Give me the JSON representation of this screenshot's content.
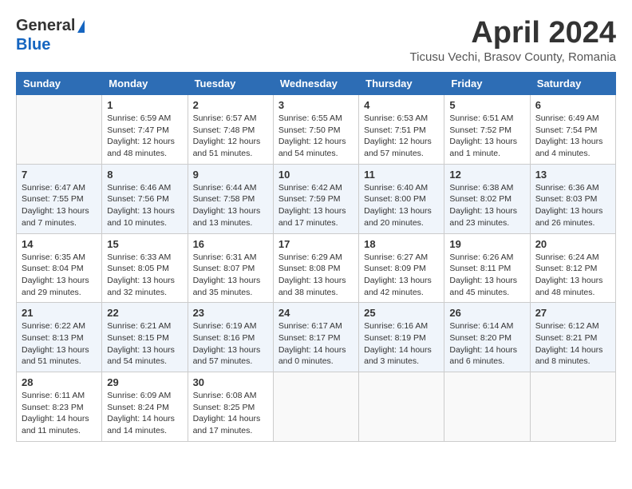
{
  "header": {
    "logo_general": "General",
    "logo_blue": "Blue",
    "month_year": "April 2024",
    "location": "Ticusu Vechi, Brasov County, Romania"
  },
  "days_of_week": [
    "Sunday",
    "Monday",
    "Tuesday",
    "Wednesday",
    "Thursday",
    "Friday",
    "Saturday"
  ],
  "weeks": [
    [
      {
        "day": "",
        "sunrise": "",
        "sunset": "",
        "daylight": ""
      },
      {
        "day": "1",
        "sunrise": "Sunrise: 6:59 AM",
        "sunset": "Sunset: 7:47 PM",
        "daylight": "Daylight: 12 hours and 48 minutes."
      },
      {
        "day": "2",
        "sunrise": "Sunrise: 6:57 AM",
        "sunset": "Sunset: 7:48 PM",
        "daylight": "Daylight: 12 hours and 51 minutes."
      },
      {
        "day": "3",
        "sunrise": "Sunrise: 6:55 AM",
        "sunset": "Sunset: 7:50 PM",
        "daylight": "Daylight: 12 hours and 54 minutes."
      },
      {
        "day": "4",
        "sunrise": "Sunrise: 6:53 AM",
        "sunset": "Sunset: 7:51 PM",
        "daylight": "Daylight: 12 hours and 57 minutes."
      },
      {
        "day": "5",
        "sunrise": "Sunrise: 6:51 AM",
        "sunset": "Sunset: 7:52 PM",
        "daylight": "Daylight: 13 hours and 1 minute."
      },
      {
        "day": "6",
        "sunrise": "Sunrise: 6:49 AM",
        "sunset": "Sunset: 7:54 PM",
        "daylight": "Daylight: 13 hours and 4 minutes."
      }
    ],
    [
      {
        "day": "7",
        "sunrise": "Sunrise: 6:47 AM",
        "sunset": "Sunset: 7:55 PM",
        "daylight": "Daylight: 13 hours and 7 minutes."
      },
      {
        "day": "8",
        "sunrise": "Sunrise: 6:46 AM",
        "sunset": "Sunset: 7:56 PM",
        "daylight": "Daylight: 13 hours and 10 minutes."
      },
      {
        "day": "9",
        "sunrise": "Sunrise: 6:44 AM",
        "sunset": "Sunset: 7:58 PM",
        "daylight": "Daylight: 13 hours and 13 minutes."
      },
      {
        "day": "10",
        "sunrise": "Sunrise: 6:42 AM",
        "sunset": "Sunset: 7:59 PM",
        "daylight": "Daylight: 13 hours and 17 minutes."
      },
      {
        "day": "11",
        "sunrise": "Sunrise: 6:40 AM",
        "sunset": "Sunset: 8:00 PM",
        "daylight": "Daylight: 13 hours and 20 minutes."
      },
      {
        "day": "12",
        "sunrise": "Sunrise: 6:38 AM",
        "sunset": "Sunset: 8:02 PM",
        "daylight": "Daylight: 13 hours and 23 minutes."
      },
      {
        "day": "13",
        "sunrise": "Sunrise: 6:36 AM",
        "sunset": "Sunset: 8:03 PM",
        "daylight": "Daylight: 13 hours and 26 minutes."
      }
    ],
    [
      {
        "day": "14",
        "sunrise": "Sunrise: 6:35 AM",
        "sunset": "Sunset: 8:04 PM",
        "daylight": "Daylight: 13 hours and 29 minutes."
      },
      {
        "day": "15",
        "sunrise": "Sunrise: 6:33 AM",
        "sunset": "Sunset: 8:05 PM",
        "daylight": "Daylight: 13 hours and 32 minutes."
      },
      {
        "day": "16",
        "sunrise": "Sunrise: 6:31 AM",
        "sunset": "Sunset: 8:07 PM",
        "daylight": "Daylight: 13 hours and 35 minutes."
      },
      {
        "day": "17",
        "sunrise": "Sunrise: 6:29 AM",
        "sunset": "Sunset: 8:08 PM",
        "daylight": "Daylight: 13 hours and 38 minutes."
      },
      {
        "day": "18",
        "sunrise": "Sunrise: 6:27 AM",
        "sunset": "Sunset: 8:09 PM",
        "daylight": "Daylight: 13 hours and 42 minutes."
      },
      {
        "day": "19",
        "sunrise": "Sunrise: 6:26 AM",
        "sunset": "Sunset: 8:11 PM",
        "daylight": "Daylight: 13 hours and 45 minutes."
      },
      {
        "day": "20",
        "sunrise": "Sunrise: 6:24 AM",
        "sunset": "Sunset: 8:12 PM",
        "daylight": "Daylight: 13 hours and 48 minutes."
      }
    ],
    [
      {
        "day": "21",
        "sunrise": "Sunrise: 6:22 AM",
        "sunset": "Sunset: 8:13 PM",
        "daylight": "Daylight: 13 hours and 51 minutes."
      },
      {
        "day": "22",
        "sunrise": "Sunrise: 6:21 AM",
        "sunset": "Sunset: 8:15 PM",
        "daylight": "Daylight: 13 hours and 54 minutes."
      },
      {
        "day": "23",
        "sunrise": "Sunrise: 6:19 AM",
        "sunset": "Sunset: 8:16 PM",
        "daylight": "Daylight: 13 hours and 57 minutes."
      },
      {
        "day": "24",
        "sunrise": "Sunrise: 6:17 AM",
        "sunset": "Sunset: 8:17 PM",
        "daylight": "Daylight: 14 hours and 0 minutes."
      },
      {
        "day": "25",
        "sunrise": "Sunrise: 6:16 AM",
        "sunset": "Sunset: 8:19 PM",
        "daylight": "Daylight: 14 hours and 3 minutes."
      },
      {
        "day": "26",
        "sunrise": "Sunrise: 6:14 AM",
        "sunset": "Sunset: 8:20 PM",
        "daylight": "Daylight: 14 hours and 6 minutes."
      },
      {
        "day": "27",
        "sunrise": "Sunrise: 6:12 AM",
        "sunset": "Sunset: 8:21 PM",
        "daylight": "Daylight: 14 hours and 8 minutes."
      }
    ],
    [
      {
        "day": "28",
        "sunrise": "Sunrise: 6:11 AM",
        "sunset": "Sunset: 8:23 PM",
        "daylight": "Daylight: 14 hours and 11 minutes."
      },
      {
        "day": "29",
        "sunrise": "Sunrise: 6:09 AM",
        "sunset": "Sunset: 8:24 PM",
        "daylight": "Daylight: 14 hours and 14 minutes."
      },
      {
        "day": "30",
        "sunrise": "Sunrise: 6:08 AM",
        "sunset": "Sunset: 8:25 PM",
        "daylight": "Daylight: 14 hours and 17 minutes."
      },
      {
        "day": "",
        "sunrise": "",
        "sunset": "",
        "daylight": ""
      },
      {
        "day": "",
        "sunrise": "",
        "sunset": "",
        "daylight": ""
      },
      {
        "day": "",
        "sunrise": "",
        "sunset": "",
        "daylight": ""
      },
      {
        "day": "",
        "sunrise": "",
        "sunset": "",
        "daylight": ""
      }
    ]
  ]
}
